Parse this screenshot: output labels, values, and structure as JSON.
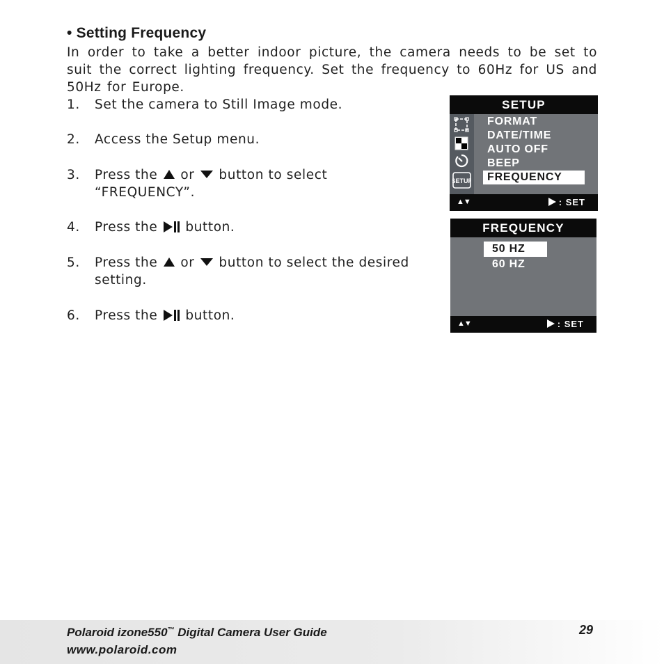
{
  "section": {
    "bullet": "•",
    "title": "Setting Frequency",
    "intro": "In order to take a better indoor picture, the camera needs to be set to suit the correct lighting frequency. Set the frequency to 60Hz for US and 50Hz for Europe."
  },
  "steps": [
    {
      "num": "1.",
      "text": "Set the camera to Still Image mode."
    },
    {
      "num": "2.",
      "text": "Access the Setup menu."
    },
    {
      "num": "3.",
      "pre": "Press the",
      "mid": "or",
      "post": "button to select",
      "line2": "“FREQUENCY”."
    },
    {
      "num": "4.",
      "pre": "Press the",
      "post": "button."
    },
    {
      "num": "5.",
      "pre": "Press the",
      "mid": "or",
      "post": "button to select the desired",
      "line2": "setting."
    },
    {
      "num": "6.",
      "pre": "Press the",
      "post": "button."
    }
  ],
  "icons": {
    "up": "up-triangle-icon",
    "down": "down-triangle-icon",
    "play_pause": "play-pause-icon"
  },
  "setup_screen": {
    "title": "SETUP",
    "sidebar_icons": [
      "format-card-icon",
      "quality-checker-icon",
      "timer-icon",
      "setup-icon"
    ],
    "setup_icon_label": "SETUP",
    "items": [
      "FORMAT",
      "DATE/TIME",
      "AUTO OFF",
      "BEEP",
      "FREQUENCY"
    ],
    "selected_index": 4,
    "footer_nav": "▲▼",
    "footer_action": ": SET"
  },
  "frequency_screen": {
    "title": "FREQUENCY",
    "options": [
      "50 HZ",
      "60 HZ"
    ],
    "selected_index": 0,
    "footer_nav": "▲▼",
    "footer_action": ": SET"
  },
  "footer": {
    "guide_prefix": "Polaroid izone550",
    "trademark": "™",
    "guide_suffix": " Digital Camera User Guide",
    "url": "www.polaroid.com",
    "page_number": "29"
  },
  "colors": {
    "lcd_background": "#717478",
    "lcd_bar": "#0b0b0b",
    "lcd_sidebar": "#555a60",
    "footer_band": "#e5e5e5"
  }
}
